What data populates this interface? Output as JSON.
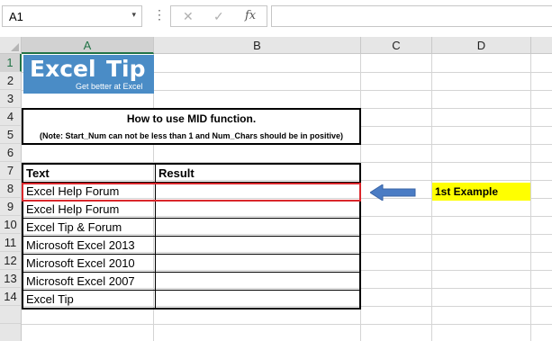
{
  "formula_bar": {
    "name_box": "A1",
    "name_box_arrow": "▾",
    "more_icon": "⋮",
    "cancel_icon": "✕",
    "enter_icon": "✓",
    "fx_label": "fx",
    "formula": ""
  },
  "columns": [
    "A",
    "B",
    "C",
    "D"
  ],
  "rows": [
    "1",
    "2",
    "3",
    "4",
    "5",
    "6",
    "7",
    "8",
    "9",
    "10",
    "11",
    "12",
    "13",
    "14"
  ],
  "logo": {
    "word1": "Excel",
    "word2": "Tip",
    "tagline": "Get better at Excel",
    "color": "#4a8cc6"
  },
  "title": {
    "main": "How to use MID function.",
    "note": "(Note: Start_Num can not be less than 1 and Num_Chars should be in positive)"
  },
  "table": {
    "headers": [
      "Text",
      "Result"
    ],
    "rows": [
      [
        "Excel Help Forum",
        ""
      ],
      [
        "Excel Help Forum",
        ""
      ],
      [
        "Excel Tip & Forum",
        ""
      ],
      [
        "Microsoft Excel 2013",
        ""
      ],
      [
        "Microsoft Excel 2010",
        ""
      ],
      [
        "Microsoft Excel 2007",
        ""
      ],
      [
        "Excel Tip",
        ""
      ]
    ]
  },
  "callout": {
    "label": "1st Example",
    "color": "#ffff00",
    "arrow_color": "#4a7cc4",
    "highlight_border": "#d9262b"
  }
}
